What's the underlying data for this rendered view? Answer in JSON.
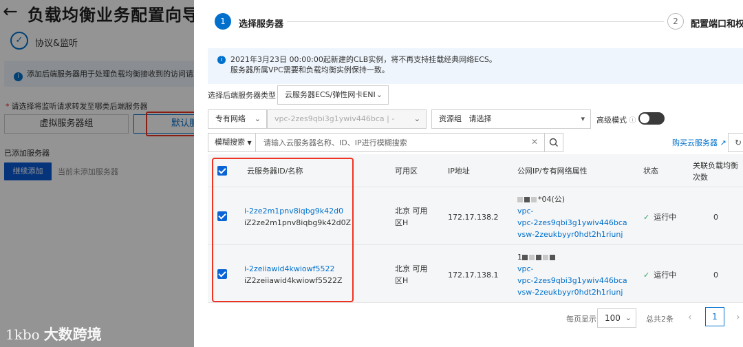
{
  "background": {
    "title": "负载均衡业务配置向导",
    "step_label": "协议&监听",
    "info_text": "添加后端服务器用于处理负载均衡接收到的访问请求",
    "ask_label": "请选择将监听请求转发至哪类后端服务器",
    "segment_vgroup": "虚拟服务器组",
    "segment_default": "默认服",
    "added_label": "已添加服务器",
    "continue_button": "继续添加",
    "none_added": "当前未添加服务器",
    "watermark": "大数跨境",
    "watermark_logo": "1kbo"
  },
  "wizard": {
    "step1_num": "1",
    "step1_label": "选择服务器",
    "step2_num": "2",
    "step2_label": "配置端口和权重"
  },
  "notice": {
    "line1": "2021年3月23日 00:00:00起新建的CLB实例，将不再支持挂载经典网络ECS。",
    "line2": "服务器所属VPC需要和负载均衡实例保持一致。"
  },
  "filters": {
    "type_label": "选择后端服务器类型",
    "type_value": "云服务器ECS/弹性网卡ENI",
    "network_value": "专有网络",
    "vpc_value": "vpc-2zes9qbi3g1ywiv446bca | -",
    "resource_group_label": "资源组",
    "resource_group_placeholder": "请选择",
    "advanced_label": "高级模式",
    "search_mode": "模糊搜索",
    "search_placeholder": "请输入云服务器名称、ID、IP进行模糊搜索",
    "buy_link": "购买云服务器"
  },
  "table": {
    "headers": {
      "name": "云服务器ID/名称",
      "zone": "可用区",
      "ip": "IP地址",
      "public": "公网IP/专有网络属性",
      "status": "状态",
      "count": "关联负载均衡次数"
    },
    "rows": [
      {
        "id": "i-2ze2m1pnv8iqbg9k42d0",
        "name": "iZ2ze2m1pnv8iqbg9k42d0Z",
        "zone": "北京 可用区H",
        "ip": "172.17.138.2",
        "public_ip": "*04(公)",
        "vpc": "vpc-2zes9qbi3g1ywiv446bca",
        "vsw": "vsw-2zeukbyyr0hdt2h1riunj",
        "status": "运行中",
        "count": "0"
      },
      {
        "id": "i-2zeiiawid4kwiowf5522",
        "name": "iZ2zeiiawid4kwiowf5522Z",
        "zone": "北京 可用区H",
        "ip": "172.17.138.1",
        "public_ip": "1",
        "vpc": "vpc-2zes9qbi3g1ywiv446bca",
        "vsw": "vsw-2zeukbyyr0hdt2h1riunj",
        "status": "运行中",
        "count": "0"
      }
    ]
  },
  "pagination": {
    "per_page_label": "每页显示",
    "per_page_value": "100",
    "total": "总共2条",
    "current_page": "1"
  },
  "colors": {
    "accent": "#0070cc",
    "highlight_frame": "#ee3322",
    "status_ok": "#2aa15d"
  }
}
